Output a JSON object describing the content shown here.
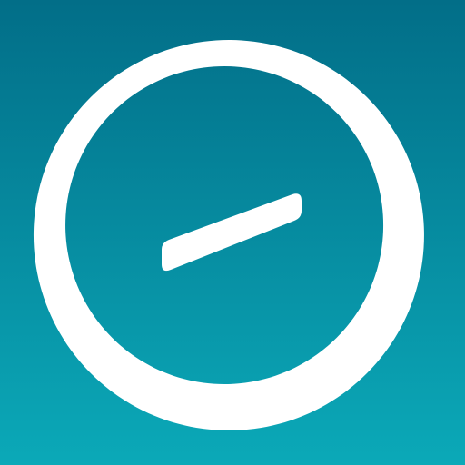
{
  "icon": {
    "name": "gauge-icon",
    "background_top": "#026e88",
    "background_bottom": "#0ba9b8",
    "foreground": "#ffffff"
  }
}
